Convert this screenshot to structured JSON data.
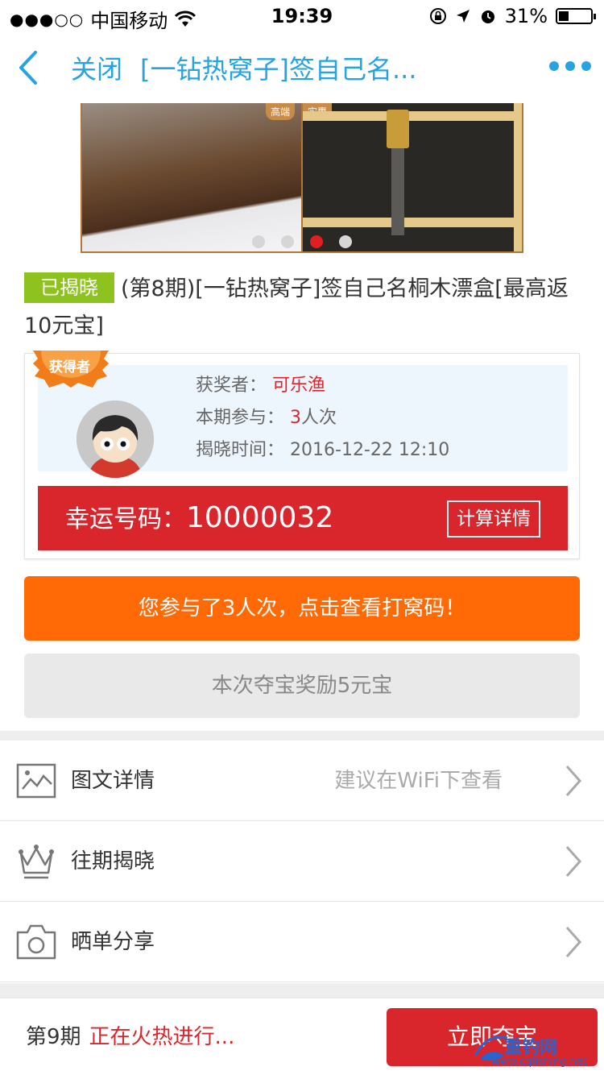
{
  "status_bar": {
    "signal": "●●●○○",
    "carrier": "中国移动",
    "time": "19:39",
    "battery": "31%",
    "battery_level": 0.31
  },
  "nav": {
    "close_label": "关闭",
    "title": "[一钻热窝子]签自己名..."
  },
  "banner": {
    "tag_left": "高端",
    "tag_right": "实惠",
    "page_count": 4,
    "active_page": 3
  },
  "product": {
    "badge": "已揭晓",
    "title": "(第8期)[一钻热窝子]签自己名桐木漂盒[最高返10元宝]"
  },
  "winner": {
    "ribbon": "获得者",
    "name_label": "获奖者：",
    "name": "可乐渔",
    "participation_label": "本期参与：",
    "participation_count": "3",
    "participation_unit": "人次",
    "reveal_label": "揭晓时间：",
    "reveal_time": "2016-12-22 12:10",
    "lucky_label": "幸运号码：",
    "lucky_number": "10000032",
    "calc_label": "计算详情"
  },
  "actions": {
    "participation_notice": "您参与了3人次，点击查看打窝码！",
    "reward_notice": "本次夺宝奖励5元宝"
  },
  "menu": {
    "detail_label": "图文详情",
    "detail_hint": "建议在WiFi下查看",
    "history_label": "往期揭晓",
    "share_label": "晒单分享"
  },
  "bottom": {
    "period": "第9期",
    "status": "正在火热进行...",
    "join_label": "立即夺宝"
  },
  "watermark": {
    "line1": "重钓网",
    "line2": "www.cqfishing.net"
  },
  "colors": {
    "accent_blue": "#26a3e0",
    "red": "#d9262c",
    "orange": "#ff6a06",
    "green_badge": "#8dc21f"
  }
}
